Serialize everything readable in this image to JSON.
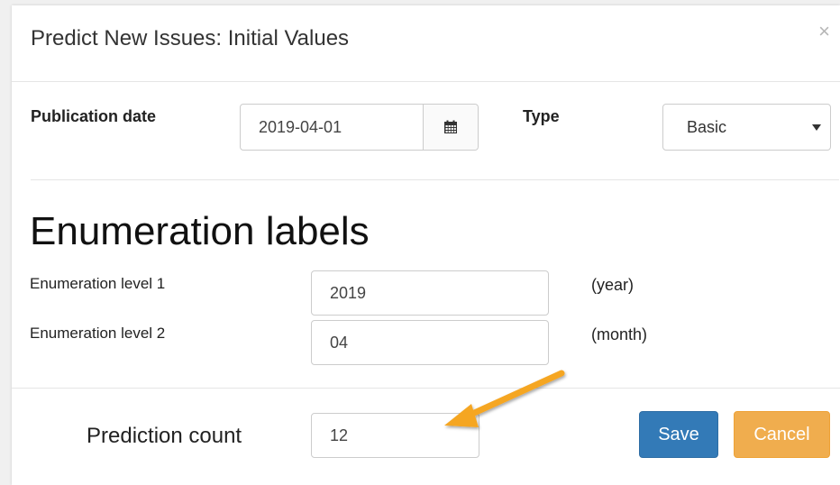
{
  "modal": {
    "title": "Predict New Issues: Initial Values",
    "close_glyph": "×"
  },
  "form": {
    "publication_date": {
      "label": "Publication date",
      "value": "2019-04-01"
    },
    "type": {
      "label": "Type",
      "value": "Basic"
    }
  },
  "enumeration": {
    "heading": "Enumeration labels",
    "levels": [
      {
        "label": "Enumeration level 1",
        "value": "2019",
        "unit": "(year)"
      },
      {
        "label": "Enumeration level 2",
        "value": "04",
        "unit": "(month)"
      }
    ]
  },
  "footer": {
    "prediction_count": {
      "label": "Prediction count",
      "value": "12"
    },
    "save_label": "Save",
    "cancel_label": "Cancel"
  },
  "icons": {
    "calendar": "calendar-icon",
    "caret": "caret-down-icon",
    "annotation_arrow": "arrow-icon"
  },
  "colors": {
    "save_button": "#337ab7",
    "cancel_button": "#f0ad4e",
    "annotation_arrow": "#f5a623"
  }
}
